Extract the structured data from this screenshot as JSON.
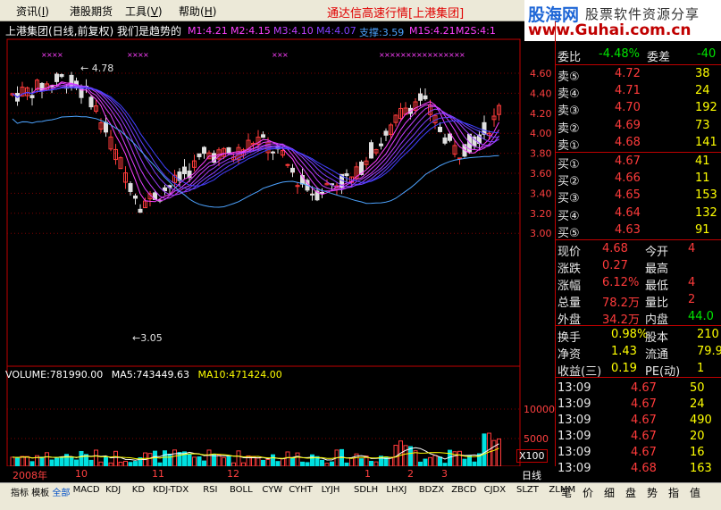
{
  "menu": [
    {
      "label": "资讯",
      "key": "I"
    },
    {
      "label": "港股期货",
      "key": ""
    },
    {
      "label": "工具",
      "key": "V"
    },
    {
      "label": "帮助",
      "key": "H"
    }
  ],
  "app_title": "通达信高速行情[上港集团]",
  "brand": {
    "name": "股海网",
    "slogan": "股票软件资源分享",
    "url": "www.Guhai.com.cn"
  },
  "chart_header": {
    "stock": "上港集团(日线,前复权) 我们是趋势的",
    "ma_labels": [
      "M1:4.21",
      "M2:4.15",
      "M3:4.10",
      "M4:4.07",
      "支撑:3.59",
      "M1S:4.21",
      "M2S:4:1"
    ]
  },
  "price_axis": [
    "4.60",
    "4.40",
    "4.20",
    "4.00",
    "3.80",
    "3.60",
    "3.40",
    "3.20",
    "3.00"
  ],
  "annotations": {
    "high": "4.78",
    "low": "3.05"
  },
  "volume": {
    "label": "VOLUME:781990.00",
    "ma5": "MA5:743449.63",
    "ma10": "MA10:471424.00",
    "axis": [
      "10000",
      "5000"
    ],
    "scale": "X100"
  },
  "timeline": {
    "labels": [
      "2008年",
      "10",
      "11",
      "12",
      "1",
      "2",
      "3"
    ],
    "period": "日线"
  },
  "quote": {
    "webi": {
      "label": "委比",
      "value": "-4.48%",
      "label2": "委差",
      "value2": "-40"
    },
    "sell": [
      {
        "label": "卖⑤",
        "price": "4.72",
        "vol": "38"
      },
      {
        "label": "卖④",
        "price": "4.71",
        "vol": "24"
      },
      {
        "label": "卖③",
        "price": "4.70",
        "vol": "192"
      },
      {
        "label": "卖②",
        "price": "4.69",
        "vol": "73"
      },
      {
        "label": "卖①",
        "price": "4.68",
        "vol": "141"
      }
    ],
    "buy": [
      {
        "label": "买①",
        "price": "4.67",
        "vol": "41"
      },
      {
        "label": "买②",
        "price": "4.66",
        "vol": "11"
      },
      {
        "label": "买③",
        "price": "4.65",
        "vol": "153"
      },
      {
        "label": "买④",
        "price": "4.64",
        "vol": "132"
      },
      {
        "label": "买⑤",
        "price": "4.63",
        "vol": "91"
      }
    ],
    "stats": [
      {
        "l1": "现价",
        "v1": "4.68",
        "l2": "今开",
        "v2": "4"
      },
      {
        "l1": "涨跌",
        "v1": "0.27",
        "l2": "最高",
        "v2": ""
      },
      {
        "l1": "涨幅",
        "v1": "6.12%",
        "l2": "最低",
        "v2": "4"
      },
      {
        "l1": "总量",
        "v1": "78.2万",
        "l2": "量比",
        "v2": "2"
      },
      {
        "l1": "外盘",
        "v1": "34.2万",
        "l2": "内盘",
        "v2": "44.0"
      }
    ],
    "extra": [
      {
        "l1": "换手",
        "v1": "0.98%",
        "l2": "股本",
        "v2": "210"
      },
      {
        "l1": "净资",
        "v1": "1.43",
        "l2": "流通",
        "v2": "79.9"
      },
      {
        "l1": "收益(三)",
        "v1": "0.19",
        "l2": "PE(动)",
        "v2": "1"
      }
    ],
    "ticks": [
      {
        "time": "13:09",
        "price": "4.67",
        "vol": "50"
      },
      {
        "time": "13:09",
        "price": "4.67",
        "vol": "24"
      },
      {
        "time": "13:09",
        "price": "4.67",
        "vol": "490"
      },
      {
        "time": "13:09",
        "price": "4.67",
        "vol": "20"
      },
      {
        "time": "13:09",
        "price": "4.67",
        "vol": "16"
      },
      {
        "time": "13:09",
        "price": "4.68",
        "vol": "163"
      }
    ]
  },
  "bottom_tabs": [
    "指标",
    "模板",
    "全部",
    "MACD",
    "KDJ",
    "KD",
    "KDJ-TDX",
    "RSI",
    "BOLL",
    "CYW",
    "CYHT",
    "LYJH",
    "SDLH",
    "LHXJ",
    "BDZX",
    "ZBCD",
    "CJDX",
    "SLZT",
    "ZLMM"
  ],
  "right_tabs": [
    "笔",
    "价",
    "细",
    "盘",
    "势",
    "指",
    "值"
  ],
  "colors": {
    "up": "#ff3b3b",
    "down": "#e0e0e0",
    "ribbon_top": "#ff40ff",
    "ribbon_bottom": "#4040ff",
    "support": "#4da3ff"
  }
}
